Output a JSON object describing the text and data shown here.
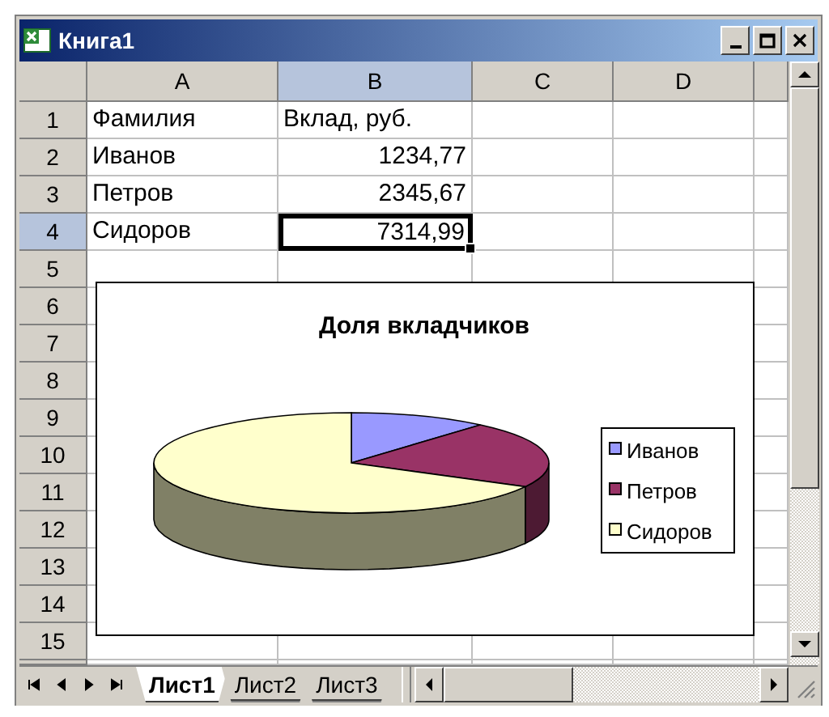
{
  "window": {
    "title": "Книга1"
  },
  "sheet": {
    "columns": [
      {
        "label": "A",
        "selected": false
      },
      {
        "label": "B",
        "selected": true
      },
      {
        "label": "C",
        "selected": false
      },
      {
        "label": "D",
        "selected": false
      }
    ],
    "rows": [
      {
        "label": "1",
        "selected": false,
        "cells": [
          {
            "kind": "text",
            "text": "Фамилия",
            "selected": false
          },
          {
            "kind": "text",
            "text": "Вклад, руб.",
            "selected": false
          }
        ]
      },
      {
        "label": "2",
        "selected": false,
        "cells": [
          {
            "kind": "text",
            "text": "Иванов",
            "selected": false
          },
          {
            "kind": "number",
            "text": "1234,77",
            "selected": false
          }
        ]
      },
      {
        "label": "3",
        "selected": false,
        "cells": [
          {
            "kind": "text",
            "text": "Петров",
            "selected": false
          },
          {
            "kind": "number",
            "text": "2345,67",
            "selected": false
          }
        ]
      },
      {
        "label": "4",
        "selected": true,
        "cells": [
          {
            "kind": "text",
            "text": "Сидоров",
            "selected": false
          },
          {
            "kind": "number",
            "text": "7314,99",
            "selected": true
          }
        ]
      },
      {
        "label": "5",
        "selected": false
      },
      {
        "label": "6",
        "selected": false
      },
      {
        "label": "7",
        "selected": false
      },
      {
        "label": "8",
        "selected": false
      },
      {
        "label": "9",
        "selected": false
      },
      {
        "label": "10",
        "selected": false
      },
      {
        "label": "11",
        "selected": false
      },
      {
        "label": "12",
        "selected": false
      },
      {
        "label": "13",
        "selected": false
      },
      {
        "label": "14",
        "selected": false
      },
      {
        "label": "15",
        "selected": false
      }
    ]
  },
  "chart": {
    "title": "Доля вкладчиков",
    "legend": [
      {
        "label": "Иванов",
        "color": "#9999ff"
      },
      {
        "label": "Петров",
        "color": "#993366"
      },
      {
        "label": "Сидоров",
        "color": "#ffffcc"
      }
    ]
  },
  "sheet_tabs": [
    {
      "label": "Лист1",
      "selected": true
    },
    {
      "label": "Лист2",
      "selected": false
    },
    {
      "label": "Лист3",
      "selected": false
    }
  ]
}
